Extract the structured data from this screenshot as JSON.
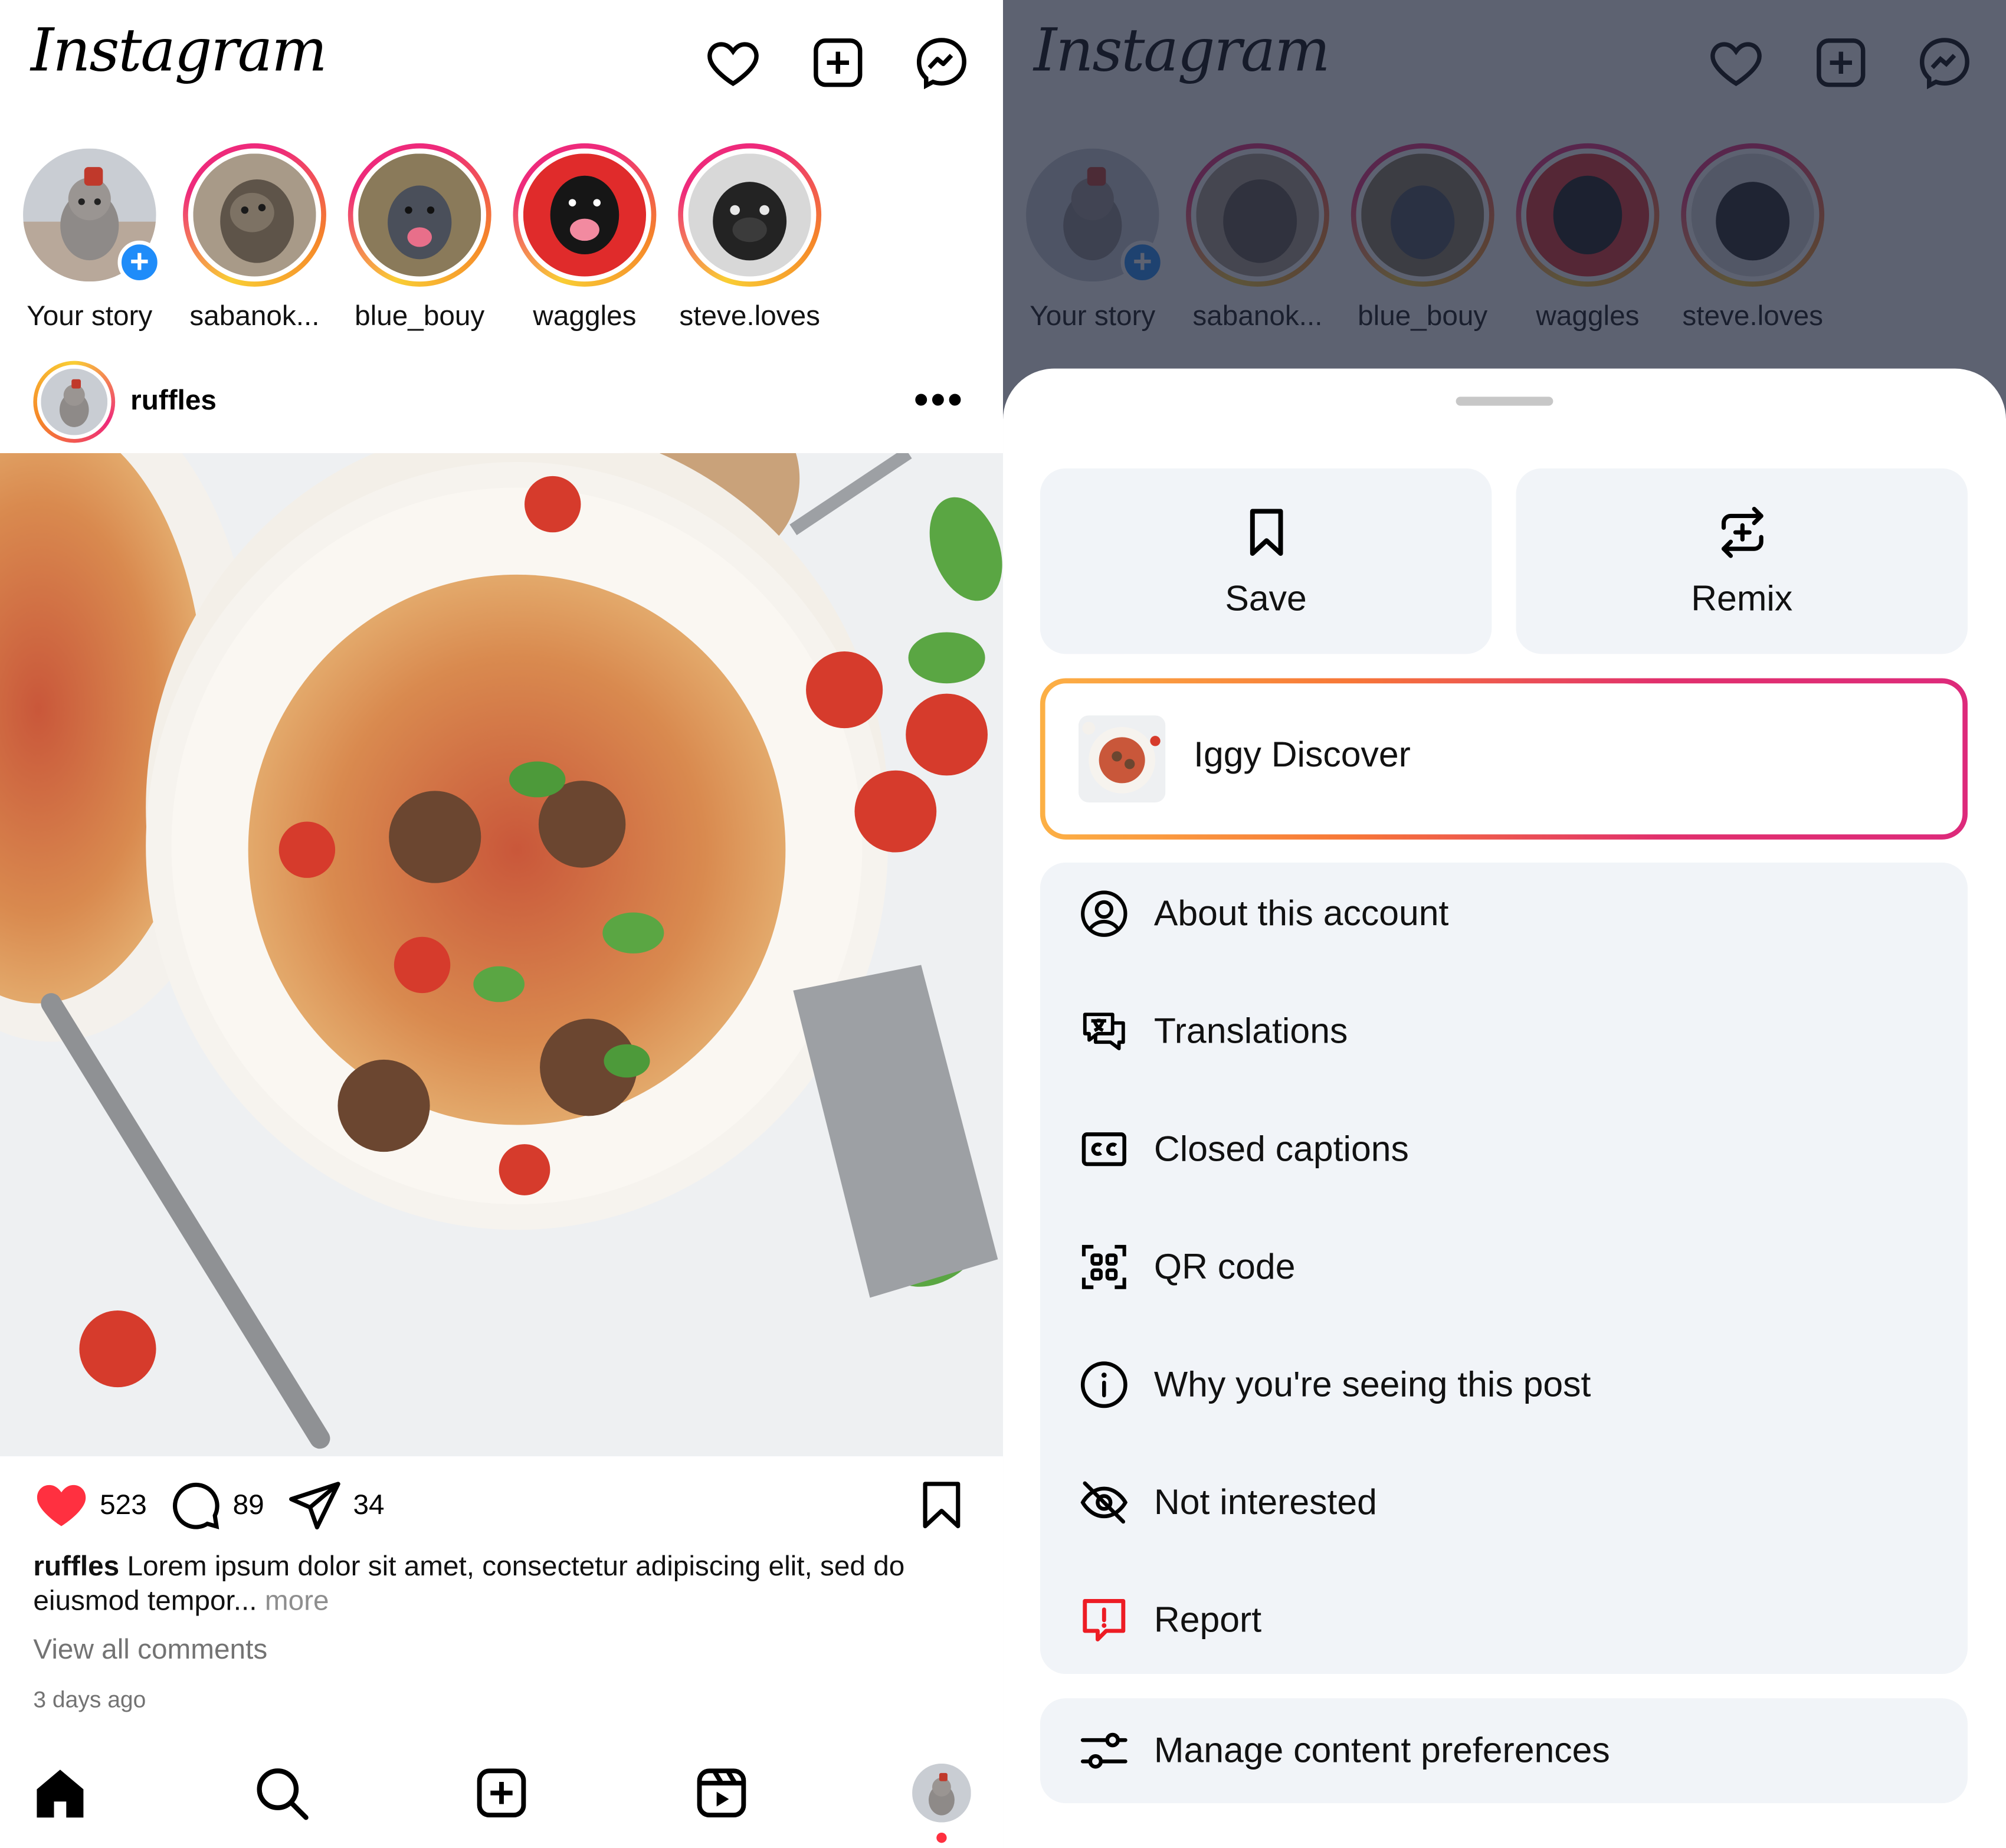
{
  "app": {
    "logo_text": "Instagram"
  },
  "stories": [
    {
      "name": "Your story",
      "own": true
    },
    {
      "name": "sabanok..."
    },
    {
      "name": "blue_bouy"
    },
    {
      "name": "waggles"
    },
    {
      "name": "steve.loves"
    }
  ],
  "post": {
    "username": "ruffles",
    "likes": "523",
    "comments": "89",
    "shares": "34",
    "caption_user": "ruffles",
    "caption_text": " Lorem ipsum dolor sit amet, consectetur adipiscing elit, sed do eiusmod tempor...",
    "caption_more": " more",
    "view_comments": "View all comments",
    "time_ago": "3 days ago"
  },
  "sheet": {
    "save_label": "Save",
    "remix_label": "Remix",
    "iggy_label": "Iggy Discover",
    "menu_items": [
      {
        "label": "About this account",
        "icon": "account-circle-icon"
      },
      {
        "label": "Translations",
        "icon": "translate-icon"
      },
      {
        "label": "Closed captions",
        "icon": "closed-captions-icon"
      },
      {
        "label": "QR code",
        "icon": "qr-code-icon"
      },
      {
        "label": "Why you're seeing this post",
        "icon": "info-icon"
      },
      {
        "label": "Not interested",
        "icon": "eye-off-icon"
      },
      {
        "label": "Report",
        "icon": "report-icon"
      }
    ],
    "prefs_label": "Manage content preferences"
  },
  "colors": {
    "accent_blue": "#1f8cf9",
    "like_red": "#ff3040",
    "report_red": "#ed1c24",
    "sheet_item_bg": "#f1f4f8"
  }
}
